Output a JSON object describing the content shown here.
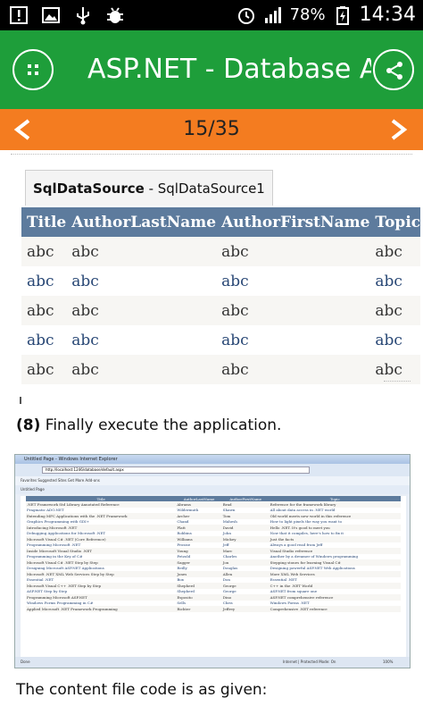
{
  "status_bar": {
    "battery_percent": "78%",
    "time": "14:34",
    "icons": [
      "warning-icon",
      "image-icon",
      "usb-icon",
      "debug-icon",
      "alarm-icon",
      "signal-icon",
      "battery-charging-icon"
    ]
  },
  "app_bar": {
    "title": "ASP.NET - Database Access",
    "menu_icon": "grid-icon",
    "share_icon": "share-icon",
    "color": "#1e9e3a"
  },
  "pager": {
    "prev_label": "<",
    "next_label": ">",
    "page": "15/35",
    "color": "#f47c20"
  },
  "figure1": {
    "tab_bold": "SqlDataSource",
    "tab_rest": " - SqlDataSource1",
    "columns": [
      "Title",
      "AuthorLastName",
      "AuthorFirstName",
      "Topic"
    ],
    "rows": [
      [
        "abc",
        "abc",
        "abc",
        "abc"
      ],
      [
        "abc",
        "abc",
        "abc",
        "abc"
      ],
      [
        "abc",
        "abc",
        "abc",
        "abc"
      ],
      [
        "abc",
        "abc",
        "abc",
        "abc"
      ],
      [
        "abc",
        "abc",
        "abc",
        "abc"
      ]
    ]
  },
  "step": {
    "number": "(8)",
    "text": " Finally execute the application."
  },
  "figure2": {
    "window_title": "Untitled Page - Windows Internet Explorer",
    "url": "http://localhost:1246/database/default.aspx",
    "favorites": "Favorites   Suggested Sites   Get More Add-ons",
    "tab": "Untitled Page",
    "columns": [
      "Title",
      "AuthorLastName",
      "AuthorFirstName",
      "Topic"
    ],
    "rows": [
      [
        ".NET Framework Std Library Annotated Reference",
        "Abrams",
        "Brad",
        "Reference for the framework library"
      ],
      [
        "Pragmatic ADO.NET",
        "Wildermuth",
        "Shawn",
        "All about data access in .NET world"
      ],
      [
        "Extending MFC Applications with the .NET Framework",
        "Archer",
        "Tom",
        "Old world meets new world in this reference"
      ],
      [
        "Graphics Programming with GDI+",
        "Chand",
        "Mahesh",
        "How to light pixels the way you want to"
      ],
      [
        "Introducing Microsoft .NET",
        "Platt",
        "David",
        "Hello .NET. It's good to meet you"
      ],
      [
        "Debugging Applications for Microsoft .NET",
        "Robbins",
        "John",
        "Now that it compiles, here's how to fix it"
      ],
      [
        "Microsoft Visual C# .NET (Core Reference)",
        "Williams",
        "Mickey",
        "Just the facts"
      ],
      [
        "Programming Microsoft .NET",
        "Prosise",
        "Jeff",
        "Always a good read from Jeff"
      ],
      [
        "Inside Microsoft Visual Studio .NET",
        "Young",
        "Marc",
        "Visual Studio reference"
      ],
      [
        "Programming in the Key of C#",
        "Petzold",
        "Charles",
        "Another by a dreamer of Windows programming"
      ],
      [
        "Microsoft Visual C# .NET Step by Step",
        "Sagger",
        "Jon",
        "Stepping stones for learning Visual C#"
      ],
      [
        "Designing Microsoft ASP.NET Applications",
        "Reilly",
        "Douglas",
        "Designing powerful ASP.NET Web Applications"
      ],
      [
        "Microsoft .NET XML Web Services Step by Step",
        "Jones",
        "Allen",
        "More XML Web Services"
      ],
      [
        "Essential .NET",
        "Box",
        "Don",
        "Essential .NET"
      ],
      [
        "Microsoft Visual C++ .NET Step by Step",
        "Shepherd",
        "George",
        "C++ in the .NET World"
      ],
      [
        "ASP.NET Step by Step",
        "Shepherd",
        "George",
        "ASP.NET from square one"
      ],
      [
        "Programming Microsoft ASP.NET",
        "Esposito",
        "Dino",
        "ASP.NET comprehensive reference"
      ],
      [
        "Windows Forms Programming in C#",
        "Sells",
        "Chris",
        "Windows Forms .NET"
      ],
      [
        "Applied Microsoft .NET Framework Programming",
        "Richter",
        "Jeffrey",
        "Comprehensive .NET reference"
      ]
    ],
    "status_text": "Done",
    "zone_text": "Internet | Protected Mode: On",
    "zoom": "100%"
  },
  "closing": {
    "text": "The content file code is as given:"
  }
}
